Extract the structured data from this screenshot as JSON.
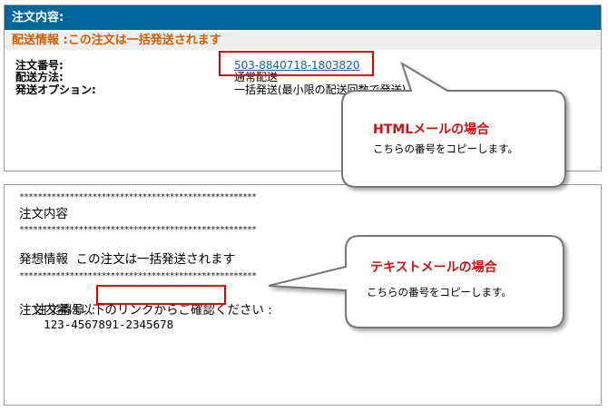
{
  "html_mail": {
    "header": "注文内容:",
    "shipping_info": "配送情報 :この注文は一括発送されます",
    "rows": [
      {
        "label": "注文番号:",
        "value": "503-8840718-1803820"
      },
      {
        "label": "配送方法:",
        "value": "通常配送"
      },
      {
        "label": "発送オプション:",
        "value": "一括発送(最小限の配送回数で発送)"
      }
    ]
  },
  "text_mail": {
    "separator": "****************************************************",
    "title": "注文内容",
    "shipping_info": "発想情報  この注文は一括発送されます",
    "order_label": "注文番号  :",
    "order_number": "123-4567891-2345678",
    "confirm_text": "注文内容は以下のリンクからご確認ください :"
  },
  "callouts": {
    "html": {
      "title": "HTMLメールの場合",
      "text": "こちらの番号をコピーします。"
    },
    "text": {
      "title": "テキストメールの場合",
      "text": "こちらの番号をコピーします。"
    }
  },
  "colors": {
    "header_bg": "#00679c",
    "shipping_text": "#d65c00",
    "highlight": "#e00000",
    "callout_title": "#d01010"
  }
}
